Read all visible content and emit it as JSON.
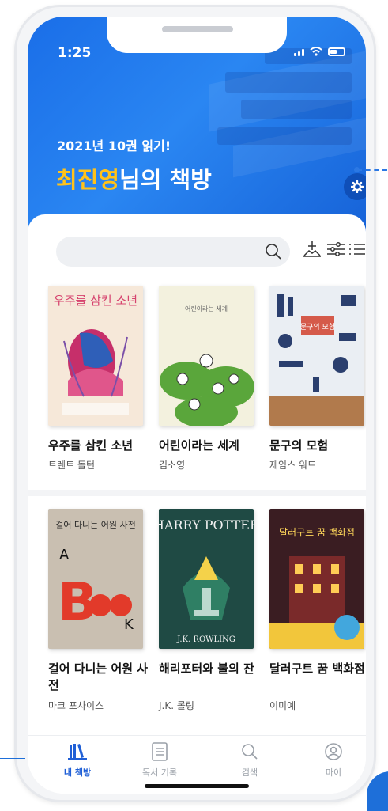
{
  "status": {
    "time": "1:25"
  },
  "header": {
    "subtitle": "2021년 10권 읽기!",
    "name": "최진영",
    "title_suffix": "님의 책방"
  },
  "toolbar": {
    "search_icon": "search-icon",
    "icons": [
      "bookshelf-add-icon",
      "filter-icon",
      "list-view-icon"
    ]
  },
  "books": [
    {
      "title": "우주를 삼킨 소년",
      "author": "트렌트 돌턴",
      "cover_text": "우주를 삼킨 소년",
      "cover_color": "#f6e8d9"
    },
    {
      "title": "어린이라는 세계",
      "author": "김소영",
      "cover_text": "어린이라는 세계",
      "cover_color": "#f3f1de"
    },
    {
      "title": "문구의 모험",
      "author": "제임스 워드",
      "cover_text": "문구의 모험",
      "cover_color": "#eaeef3"
    },
    {
      "title": "걸어 다니는 어원 사전",
      "author": "마크 포사이스",
      "cover_text": "걸어 다니는 어원 사전",
      "cover_color": "#c9bfb1"
    },
    {
      "title": "해리포터와 불의 잔",
      "author": "J.K. 롤링",
      "cover_text": "HARRY POTTER",
      "cover_subtext": "J.K. ROWLING",
      "cover_color": "#1f4a44"
    },
    {
      "title": "달러구트 꿈 백화점",
      "author": "이미예",
      "cover_text": "달러구트 꿈 백화점",
      "cover_color": "#3a1d22"
    }
  ],
  "tabs": [
    {
      "label": "내 책방",
      "icon": "bookshelf-icon",
      "active": true
    },
    {
      "label": "독서 기록",
      "icon": "document-icon",
      "active": false
    },
    {
      "label": "검색",
      "icon": "search-icon",
      "active": false
    },
    {
      "label": "마이",
      "icon": "user-icon",
      "active": false
    }
  ],
  "colors": {
    "accent": "#1f5fd6",
    "highlight": "#ffc21a",
    "hero": "#1a6ee8"
  }
}
